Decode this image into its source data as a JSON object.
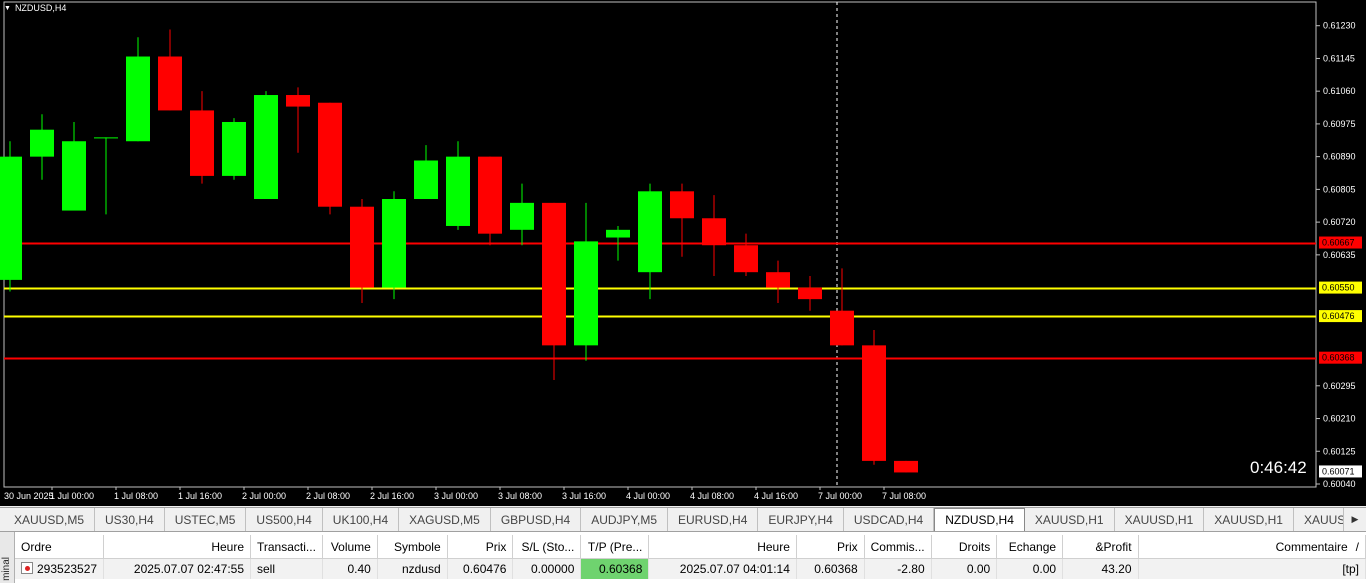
{
  "chart": {
    "symbol_title": "NZDUSD,H4",
    "countdown": "0:46:42",
    "price_axis": {
      "min": 0.6004,
      "max": 0.6125,
      "ticks": [
        "0.61230",
        "0.61145",
        "0.61060",
        "0.60975",
        "0.60890",
        "0.60805",
        "0.60720",
        "0.60635",
        "0.60295",
        "0.60210",
        "0.60125",
        "0.60040"
      ]
    },
    "time_labels": [
      {
        "label": "30 Jun 2025",
        "index": -0.2
      },
      {
        "label": "1 Jul 00:00",
        "index": 1.5
      },
      {
        "label": "1 Jul 08:00",
        "index": 3.5
      },
      {
        "label": "1 Jul 16:00",
        "index": 5.5
      },
      {
        "label": "2 Jul 00:00",
        "index": 7.5
      },
      {
        "label": "2 Jul 08:00",
        "index": 9.5
      },
      {
        "label": "2 Jul 16:00",
        "index": 11.5
      },
      {
        "label": "3 Jul 00:00",
        "index": 13.5
      },
      {
        "label": "3 Jul 08:00",
        "index": 15.5
      },
      {
        "label": "3 Jul 16:00",
        "index": 17.5
      },
      {
        "label": "4 Jul 00:00",
        "index": 19.5
      },
      {
        "label": "4 Jul 08:00",
        "index": 21.5
      },
      {
        "label": "4 Jul 16:00",
        "index": 23.5
      },
      {
        "label": "7 Jul 00:00",
        "index": 25.5
      },
      {
        "label": "7 Jul 08:00",
        "index": 27.5
      }
    ],
    "hlines": [
      {
        "price": 0.60667,
        "label": "0.60667",
        "color": "#ff0000",
        "label_bg": "#ff0000",
        "label_fg": "#000000"
      },
      {
        "price": 0.6055,
        "label": "0.60550",
        "color": "#ffff00",
        "label_bg": "#ffff00",
        "label_fg": "#000000"
      },
      {
        "price": 0.60476,
        "label": "0.60476",
        "color": "#ffff00",
        "label_bg": "#ffff00",
        "label_fg": "#000000"
      },
      {
        "price": 0.60368,
        "label": "0.60368",
        "color": "#ff0000",
        "label_bg": "#ff0000",
        "label_fg": "#000000"
      }
    ],
    "last_price_label": "0.60071",
    "crosshair_index": 26,
    "colors": {
      "bull": "#00ff00",
      "bear": "#ff0000",
      "wick_bull": "#00ff00",
      "wick_bear": "#ff0000",
      "background": "#000000",
      "axis_text": "#ffffff"
    },
    "candles": [
      {
        "o": 0.6057,
        "h": 0.6093,
        "l": 0.6054,
        "c": 0.6089
      },
      {
        "o": 0.6089,
        "h": 0.61,
        "l": 0.6083,
        "c": 0.6096
      },
      {
        "o": 0.6075,
        "h": 0.6098,
        "l": 0.6075,
        "c": 0.6093
      },
      {
        "o": 0.6094,
        "h": 0.6094,
        "l": 0.6074,
        "c": 0.6094
      },
      {
        "o": 0.6093,
        "h": 0.612,
        "l": 0.6093,
        "c": 0.6115
      },
      {
        "o": 0.6115,
        "h": 0.6122,
        "l": 0.6101,
        "c": 0.6101
      },
      {
        "o": 0.6101,
        "h": 0.6106,
        "l": 0.6082,
        "c": 0.6084
      },
      {
        "o": 0.6084,
        "h": 0.6099,
        "l": 0.6083,
        "c": 0.6098
      },
      {
        "o": 0.6078,
        "h": 0.6106,
        "l": 0.6078,
        "c": 0.6105
      },
      {
        "o": 0.6105,
        "h": 0.6107,
        "l": 0.609,
        "c": 0.6102
      },
      {
        "o": 0.6103,
        "h": 0.6103,
        "l": 0.6074,
        "c": 0.6076
      },
      {
        "o": 0.6076,
        "h": 0.6078,
        "l": 0.6051,
        "c": 0.6055
      },
      {
        "o": 0.6055,
        "h": 0.608,
        "l": 0.6052,
        "c": 0.6078
      },
      {
        "o": 0.6078,
        "h": 0.6092,
        "l": 0.6078,
        "c": 0.6088
      },
      {
        "o": 0.6071,
        "h": 0.6093,
        "l": 0.607,
        "c": 0.6089
      },
      {
        "o": 0.6089,
        "h": 0.6089,
        "l": 0.6066,
        "c": 0.6069
      },
      {
        "o": 0.607,
        "h": 0.6082,
        "l": 0.6066,
        "c": 0.6077
      },
      {
        "o": 0.6077,
        "h": 0.6077,
        "l": 0.6031,
        "c": 0.604
      },
      {
        "o": 0.604,
        "h": 0.6077,
        "l": 0.6036,
        "c": 0.6067
      },
      {
        "o": 0.6068,
        "h": 0.6071,
        "l": 0.6062,
        "c": 0.607
      },
      {
        "o": 0.6059,
        "h": 0.6082,
        "l": 0.6052,
        "c": 0.608
      },
      {
        "o": 0.608,
        "h": 0.6082,
        "l": 0.6063,
        "c": 0.6073
      },
      {
        "o": 0.6073,
        "h": 0.6079,
        "l": 0.6058,
        "c": 0.6066
      },
      {
        "o": 0.6066,
        "h": 0.6069,
        "l": 0.6058,
        "c": 0.6059
      },
      {
        "o": 0.6059,
        "h": 0.6062,
        "l": 0.6051,
        "c": 0.6055
      },
      {
        "o": 0.6055,
        "h": 0.6058,
        "l": 0.6049,
        "c": 0.6052
      },
      {
        "o": 0.6049,
        "h": 0.606,
        "l": 0.604,
        "c": 0.604
      },
      {
        "o": 0.604,
        "h": 0.6044,
        "l": 0.6009,
        "c": 0.601
      },
      {
        "o": 0.601,
        "h": 0.601,
        "l": 0.6007,
        "c": 0.6007
      }
    ]
  },
  "tabs": [
    {
      "label": "XAUUSD,M5",
      "active": false
    },
    {
      "label": "US30,H4",
      "active": false
    },
    {
      "label": "USTEC,M5",
      "active": false
    },
    {
      "label": "US500,H4",
      "active": false
    },
    {
      "label": "UK100,H4",
      "active": false
    },
    {
      "label": "XAGUSD,M5",
      "active": false
    },
    {
      "label": "GBPUSD,H4",
      "active": false
    },
    {
      "label": "AUDJPY,M5",
      "active": false
    },
    {
      "label": "EURUSD,H4",
      "active": false
    },
    {
      "label": "EURJPY,H4",
      "active": false
    },
    {
      "label": "USDCAD,H4",
      "active": false
    },
    {
      "label": "NZDUSD,H4",
      "active": true
    },
    {
      "label": "XAUUSD,H1",
      "active": false
    },
    {
      "label": "XAUUSD,H1",
      "active": false
    },
    {
      "label": "XAUUSD,H1",
      "active": false
    },
    {
      "label": "XAUUSD,Weekly",
      "active": false
    }
  ],
  "tab_scroll_icon": "triangle-right-icon",
  "terminal": {
    "side_label": "minal",
    "columns": [
      {
        "label": "Ordre",
        "align": "l"
      },
      {
        "label": "Heure",
        "align": "r"
      },
      {
        "label": "Transacti...",
        "align": "l"
      },
      {
        "label": "Volume",
        "align": "r"
      },
      {
        "label": "Symbole",
        "align": "r"
      },
      {
        "label": "Prix",
        "align": "r"
      },
      {
        "label": "S/L (Sto...",
        "align": "r"
      },
      {
        "label": "T/P (Pre...",
        "align": "r"
      },
      {
        "label": "Heure",
        "align": "r"
      },
      {
        "label": "Prix",
        "align": "r"
      },
      {
        "label": "Commis...",
        "align": "r"
      },
      {
        "label": "Droits",
        "align": "r"
      },
      {
        "label": "Echange",
        "align": "r"
      },
      {
        "label": "&Profit",
        "align": "r"
      },
      {
        "label": "Commentaire",
        "align": "r"
      }
    ],
    "sort_indicator": "/",
    "rows": [
      {
        "cells": [
          "293523527",
          "2025.07.07 02:47:55",
          "sell",
          "0.40",
          "nzdusd",
          "0.60476",
          "0.00000",
          "0.60368",
          "2025.07.07 04:01:14",
          "0.60368",
          "-2.80",
          "0.00",
          "0.00",
          "43.20",
          "[tp]"
        ]
      }
    ]
  }
}
